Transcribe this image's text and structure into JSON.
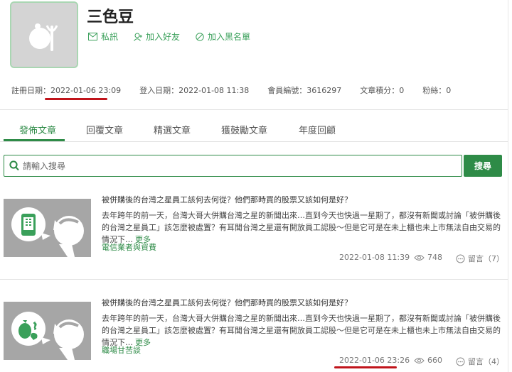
{
  "profile": {
    "name": "三色豆",
    "actions": {
      "message": "私訊",
      "add_friend": "加入好友",
      "block": "加入黑名單"
    },
    "meta": {
      "registered": "註冊日期：2022-01-06 23:09",
      "login": "登入日期：2022-01-08 11:38",
      "member_no": "會員編號：3616297",
      "points": "文章積分：0",
      "fans": "粉絲：0"
    }
  },
  "tabs": [
    "發佈文章",
    "回覆文章",
    "精選文章",
    "獲鼓勵文章",
    "年度回顧"
  ],
  "search": {
    "placeholder": "請輸入搜尋",
    "button_label": "搜尋"
  },
  "articles": [
    {
      "title": "被併購後的台灣之星員工該何去何從？他們那時買的股票又該如何是好？",
      "excerpt": "去年跨年的前一天，台灣大哥大併購台灣之星的新聞出來…直到今天也快過一星期了，都沒有新聞或討論「被併購後的台灣之星員工」該怎麼被處置？有耳聞台灣之星還有開放員工認股～但是它可是在未上櫃也未上市無法自由交易的情況下…",
      "more": "更多",
      "category": "電信業者與資費",
      "date": "2022-01-08 11:39",
      "views": "748",
      "comments": "留言（7）",
      "thumb_icon": "phone-icon"
    },
    {
      "title": "被併購後的台灣之星員工該何去何從？他們那時買的股票又該如何是好？",
      "excerpt": "去年跨年的前一天，台灣大哥大併購台灣之星的新聞出來…直到今天也快過一星期了，都沒有新聞或討論「被併購後的台灣之星員工」該怎麼被處置？有耳聞台灣之星還有開放員工認股～但是它可是在未上櫃也未上市無法自由交易的情況下…",
      "more": "更多",
      "category": "職場甘苦談",
      "date": "2022-01-06 23:26",
      "views": "660",
      "comments": "留言（4）",
      "thumb_icon": "money-bag-icon"
    }
  ],
  "colors": {
    "accent": "#2e8b47",
    "annotation_underline": "#c0141b"
  }
}
